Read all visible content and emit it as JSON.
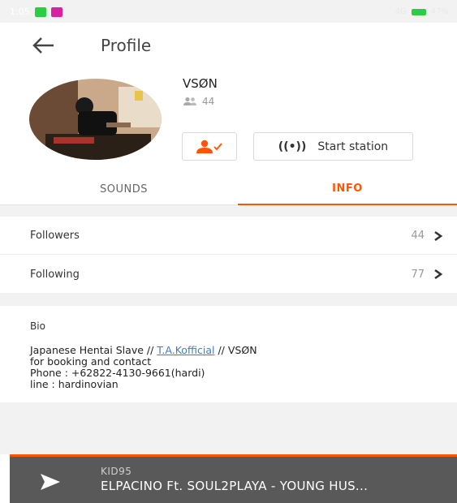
{
  "status_bar": {
    "time": "1:05",
    "network": "4G",
    "battery": "47%"
  },
  "header": {
    "title": "Profile"
  },
  "profile": {
    "username": "VSØN",
    "follower_count": "44"
  },
  "actions": {
    "start_station_label": "Start station",
    "station_glyph": "((•))"
  },
  "tabs": {
    "sounds_label": "SOUNDS",
    "info_label": "INFO"
  },
  "stats": {
    "followers_label": "Followers",
    "followers_count": "44",
    "following_label": "Following",
    "following_count": "77"
  },
  "bio": {
    "heading": "Bio",
    "line1_prefix": "Japanese Hentai Slave // ",
    "line1_link": "T.A.Kofficial",
    "line1_suffix": " // VSØN",
    "line2": "for booking and contact",
    "line3": "Phone : +62822-4130-9661(hardi)",
    "line4": "line : hardinovian"
  },
  "player": {
    "artist": "KID95",
    "track": "ELPACINO Ft. SOUL2PLAYA - YOUNG HUS..."
  },
  "colors": {
    "accent": "#ff5500",
    "player_bg": "#595959",
    "link": "#3d7ec5"
  }
}
